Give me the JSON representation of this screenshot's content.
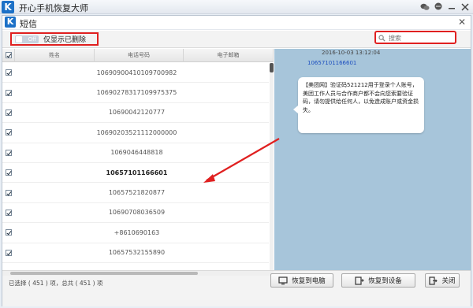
{
  "app": {
    "title": "开心手机恢复大师",
    "logo": "K"
  },
  "dialog": {
    "title": "短信",
    "logo": "K"
  },
  "toolbar": {
    "toggle_label": "Off",
    "filter_label": "仅显示已删除",
    "search_placeholder": "搜索"
  },
  "table": {
    "columns": [
      "姓名",
      "电话号码",
      "电子邮箱"
    ],
    "rows": [
      {
        "phone": "1069090041010970098​2",
        "checked": true
      },
      {
        "phone": "10690278317109975375",
        "checked": true
      },
      {
        "phone": "1069004212077​7",
        "checked": true
      },
      {
        "phone": "10690203521112000000",
        "checked": true
      },
      {
        "phone": "106904644881​8",
        "checked": true
      },
      {
        "phone": "10657101166601",
        "checked": true,
        "bold": true
      },
      {
        "phone": "10657521820877",
        "checked": true
      },
      {
        "phone": "10690708036509",
        "checked": true
      },
      {
        "phone": "+8610690163",
        "checked": true
      },
      {
        "phone": "10657532155890",
        "checked": true
      }
    ]
  },
  "preview": {
    "date": "2016-10-03 13:12:04",
    "sender": "10657101166601",
    "message": "【美团网】验证码521212用于登录个人账号，美团工作人员与合作商户都不会向您索要验证码，请勿提供给任何人，以免造成账户或资金损失。"
  },
  "footer": {
    "count_text": "已选择 ( 451 ) 项，总共 ( 451 ) 项",
    "restore_pc_label": "恢复到电脑",
    "restore_device_label": "恢复到设备",
    "close_label": "关闭"
  },
  "colors": {
    "accent": "#1d71c7",
    "highlight": "#e02020",
    "preview_bg": "#a7c5da"
  }
}
